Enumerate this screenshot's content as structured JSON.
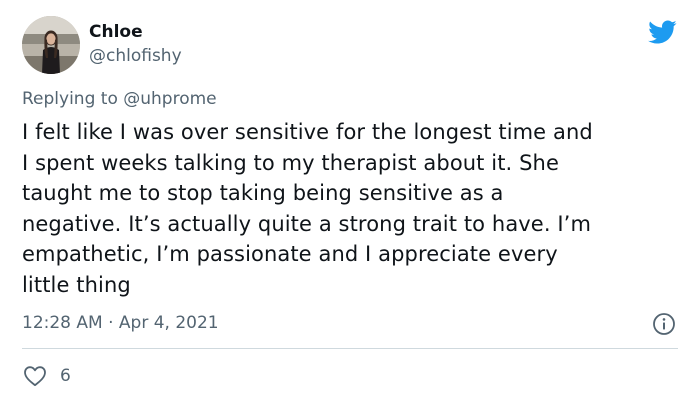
{
  "author": {
    "display_name": "Chloe",
    "handle": "@chlofishy",
    "avatar_icon": "profile-photo"
  },
  "brand": {
    "logo_icon": "twitter-bird-icon",
    "color": "#1d9bf0"
  },
  "reply": {
    "prefix": "Replying to",
    "mention": "@uhprome"
  },
  "tweet": {
    "lines": [
      "I felt like I was over sensitive for the longest time and",
      "I spent weeks talking to my therapist about it. She",
      "taught me to stop taking being sensitive as a",
      "negative. It’s actually quite a strong trait to have. I’m",
      "empathetic, I’m passionate and I appreciate every",
      "little thing"
    ]
  },
  "meta": {
    "time": "12:28 AM",
    "separator": "·",
    "date": "Apr 4, 2021"
  },
  "actions": {
    "like_count": "6",
    "like_icon": "heart-outline-icon",
    "info_icon": "info-icon"
  },
  "colors": {
    "text_primary": "#0f1419",
    "text_secondary": "#536471",
    "divider": "#cfd9de"
  }
}
